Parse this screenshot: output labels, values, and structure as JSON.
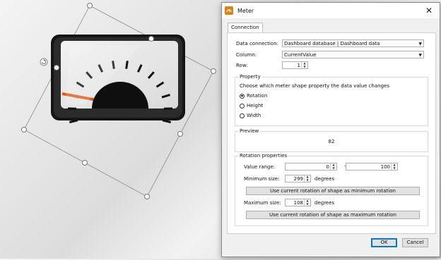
{
  "canvas": {
    "gauge": {
      "needle_color": "#e05a1a",
      "tick_count": 14
    },
    "rotate_handle": {
      "icon": "rotate-icon"
    }
  },
  "dialog": {
    "title": "Meter",
    "close_glyph": "✕",
    "tabs": [
      {
        "label": "Connection"
      }
    ],
    "data_connection": {
      "label": "Data connection:",
      "value": "Dashboard database | Dashboard data"
    },
    "column": {
      "label": "Column:",
      "value": "CurrentValue"
    },
    "row": {
      "label": "Row:",
      "value": "1"
    },
    "property": {
      "title": "Property",
      "description": "Choose which meter shape property the data value changes",
      "options": [
        {
          "label": "Rotation",
          "checked": true
        },
        {
          "label": "Height",
          "checked": false
        },
        {
          "label": "Width",
          "checked": false
        }
      ]
    },
    "preview": {
      "title": "Preview",
      "value": "82"
    },
    "rotation_properties": {
      "title": "Rotation properties",
      "value_range": {
        "label": "Value range:",
        "min": "0",
        "separator": "-",
        "max": "100"
      },
      "minimum_size": {
        "label": "Minimum size:",
        "value": "299",
        "unit": "degrees"
      },
      "min_button": "Use current rotation of shape as minimum rotation",
      "maximum_size": {
        "label": "Maximum size:",
        "value": "108",
        "unit": "degrees"
      },
      "max_button": "Use current rotation of shape as maximum rotation"
    },
    "buttons": {
      "ok": "OK",
      "cancel": "Cancel"
    }
  }
}
